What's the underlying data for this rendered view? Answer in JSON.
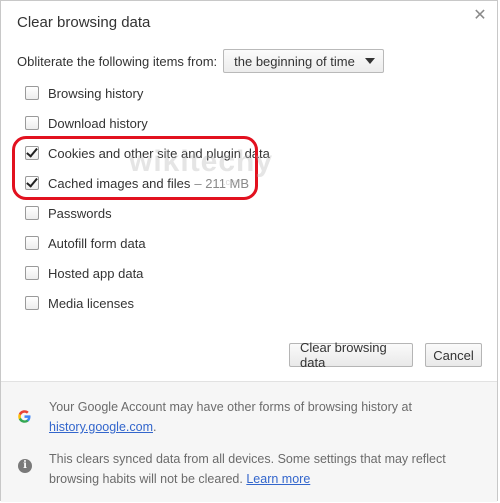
{
  "dialog": {
    "title": "Clear browsing data",
    "close_icon": "close-icon"
  },
  "obliterate": {
    "label": "Obliterate the following items from:",
    "selected": "the beginning of time"
  },
  "items": [
    {
      "label": "Browsing history",
      "checked": false,
      "size": ""
    },
    {
      "label": "Download history",
      "checked": false,
      "size": ""
    },
    {
      "label": "Cookies and other site and plugin data",
      "checked": true,
      "size": ""
    },
    {
      "label": "Cached images and files",
      "checked": true,
      "size": "–  211 MB"
    },
    {
      "label": "Passwords",
      "checked": false,
      "size": ""
    },
    {
      "label": "Autofill form data",
      "checked": false,
      "size": ""
    },
    {
      "label": "Hosted app data",
      "checked": false,
      "size": ""
    },
    {
      "label": "Media licenses",
      "checked": false,
      "size": ""
    }
  ],
  "watermark": {
    "text": "wikitechy",
    "sub": ".com"
  },
  "buttons": {
    "clear": "Clear browsing data",
    "cancel": "Cancel"
  },
  "footer": {
    "google_text": "Your Google Account may have other forms of browsing history at",
    "google_link": "history.google.com",
    "google_suffix": ".",
    "sync_text": "This clears synced data from all devices. Some settings that may reflect browsing habits will not be cleared.",
    "sync_link": "Learn more"
  },
  "colors": {
    "highlight": "#e2111f",
    "link": "#3366cc"
  }
}
